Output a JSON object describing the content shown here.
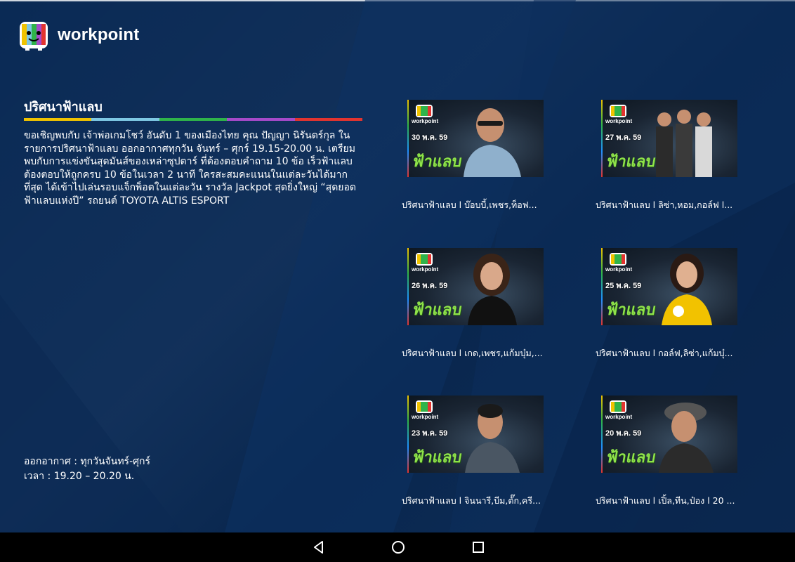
{
  "app": {
    "brand": "workpoint",
    "logo_icon": "tv-character-icon"
  },
  "show": {
    "title": "ปริศนาฟ้าแลบ",
    "description": "ขอเชิญพบกับ เจ้าพ่อเกมโชว์ อันดับ 1 ของเมืองไทย  คุณ ปัญญา นิรันดร์กุล ในรายการปริศนาฟ้าแลบ  ออกอากาศทุกวัน จันทร์ – ศุกร์ 19.15-20.00 น. เตรียมพบกับการแข่งขันสุดมันส์ของเหล่าซุปตาร์ ที่ต้องตอบคำถาม 10 ข้อ เร็วฟ้าแลบ ต้องตอบให้ถูกครบ 10 ข้อในเวลา 2 นาที ใครสะสมคะแนนในแต่ละวันได้มากที่สุด ได้เข้าไปเล่นรอบแจ็กพ็อตในแต่ละวัน รางวัล Jackpot สุดยิ่งใหญ่ “สุดยอดฟ้าแลบแห่งปี” รถยนต์ TOYOTA  ALTIS ESPORT",
    "air_days": "ออกอากาศ : ทุกวันจันทร์-ศุกร์",
    "air_time": "เวลา : 19.20 – 20.20 น.",
    "rainbow_colors": [
      "#f0c300",
      "#7ec8e3",
      "#2fb44a",
      "#a64ac9",
      "#e3342f"
    ]
  },
  "episodes": [
    {
      "date": "30 พ.ค. 59",
      "label": "ปริศนาฟ้าแลบ l บ๊อบบี้,เพชร,ท็อฟ...",
      "show_mark": "ฟ้าแลบ"
    },
    {
      "date": "27 พ.ค. 59",
      "label": "ปริศนาฟ้าแลบ l ลิซ่า,หอม,กอล์ฟ l...",
      "show_mark": "ฟ้าแลบ"
    },
    {
      "date": "26 พ.ค. 59",
      "label": "ปริศนาฟ้าแลบ l เกด,เพชร,แก้มบุ๋ม,...",
      "show_mark": "ฟ้าแลบ"
    },
    {
      "date": "25 พ.ค. 59",
      "label": "ปริศนาฟ้าแลบ l กอล์ฟ,ลิซ่า,แก้มบุ๋...",
      "show_mark": "ฟ้าแลบ"
    },
    {
      "date": "23 พ.ค. 59",
      "label": "ปริศนาฟ้าแลบ l จินนารี,บีม,ตั๊ก,ครี...",
      "show_mark": "ฟ้าแลบ"
    },
    {
      "date": "20 พ.ค. 59",
      "label": "ปริศนาฟ้าแลบ l เปิ้ล,ทีน,ป๋อง l 20 ...",
      "show_mark": "ฟ้าแลบ"
    }
  ],
  "thumb_wordmark": "workpoint",
  "navigation": {
    "back_icon": "back-triangle-icon",
    "home_icon": "home-circle-icon",
    "recents_icon": "recents-square-icon"
  }
}
